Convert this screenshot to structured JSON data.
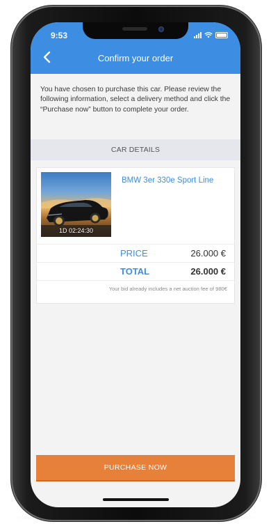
{
  "status_bar": {
    "time": "9:53"
  },
  "nav": {
    "title": "Confirm your order"
  },
  "intro_text": "You have chosen to purchase this car. Please review the following information, select a delivery method and click the “Purchase now” button to complete your order.",
  "section": {
    "car_details_label": "CAR DETAILS"
  },
  "car": {
    "name": "BMW 3er 330e Sport Line",
    "timer": "1D 02:24:30",
    "price_label": "PRICE",
    "price_value": "26.000 €",
    "total_label": "TOTAL",
    "total_value": "26.000 €",
    "fee_note": "Your bid already includes a net auction fee of 980€"
  },
  "actions": {
    "purchase_label": "PURCHASE NOW"
  },
  "colors": {
    "accent": "#3d8ee2",
    "button": "#e7813a"
  },
  "icons": {
    "back": "chevron-left-icon",
    "signal": "signal-icon",
    "wifi": "wifi-icon",
    "battery": "battery-icon"
  }
}
